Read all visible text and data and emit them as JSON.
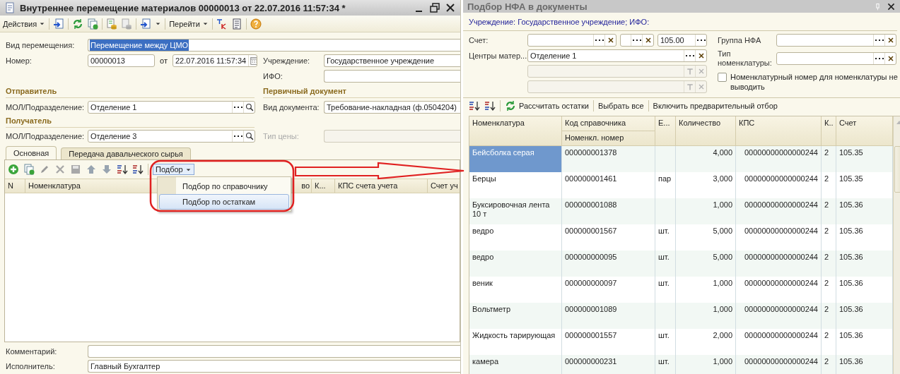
{
  "left_window": {
    "title": "Внутреннее перемещение материалов 00000013 от 22.07.2016 11:57:34 *",
    "toolbar": {
      "actions_menu": "Действия",
      "goto_menu": "Перейти"
    },
    "movement_type": {
      "label": "Вид перемещения:",
      "value": "Перемещение между ЦМО",
      "highlighted": true
    },
    "number": {
      "label": "Номер:",
      "value": "00000013"
    },
    "date": {
      "label": "от",
      "value": "22.07.2016 11:57:34"
    },
    "institution": {
      "label": "Учреждение:",
      "value": "Государственное учреждение"
    },
    "ifo": {
      "label": "ИФО:"
    },
    "sender": {
      "heading": "Отправитель",
      "label": "МОЛ/Подразделение:",
      "value": "Отделение 1"
    },
    "primary_document": {
      "heading": "Первичный документ",
      "label": "Вид документа:",
      "value": "Требование-накладная (ф.0504204)"
    },
    "recipient": {
      "heading": "Получатель",
      "label": "МОЛ/Подразделение:",
      "value": "Отделение 3"
    },
    "price_type": {
      "label": "Тип цены:",
      "disabled": true
    },
    "tabs": [
      {
        "label": "Основная",
        "selected": true
      },
      {
        "label": "Передача давальческого сырья",
        "selected": false
      }
    ],
    "pick_button": {
      "label": "Подбор",
      "pressed": true
    },
    "pick_menu": [
      {
        "label": "Подбор по справочнику",
        "selected": false
      },
      {
        "label": "Подбор по остаткам",
        "selected": true
      }
    ],
    "table": {
      "columns": [
        "N",
        "Номенклатура",
        "во",
        "К...",
        "КПС счета учета",
        "Счет уч"
      ]
    },
    "comment": {
      "label": "Комментарий:"
    },
    "executor": {
      "label": "Исполнитель:",
      "value": "Главный Бухгалтер"
    }
  },
  "right_window": {
    "title": "Подбор НФА в документы",
    "info": "Учреждение: Государственное учреждение; ИФО:",
    "account": {
      "label": "Счет:",
      "code": "105.00"
    },
    "centers": {
      "label": "Центры матер...",
      "value": "Отделение 1"
    },
    "nfa_group": {
      "label": "Группа НФА"
    },
    "nomenclature_type": {
      "label": "Тип номенклатуры:"
    },
    "hide_number": {
      "label": "Номенклатурный номер для номенклатуры не выводить",
      "checked": false
    },
    "toolbar": [
      "Рассчитать остатки",
      "Выбрать все",
      "Включить предварительный отбор"
    ],
    "table": {
      "columns": [
        {
          "label": "Номенклатура"
        },
        {
          "label": "Код справочника",
          "sublabel": "Номенкл. номер"
        },
        {
          "label": "Е..."
        },
        {
          "label": "Количество"
        },
        {
          "label": "КПС"
        },
        {
          "label": "К.."
        },
        {
          "label": "Счет"
        }
      ],
      "rows": [
        {
          "name": "Бейсболка серая",
          "code": "000000001378",
          "quantity": "4,000",
          "kps": "00000000000000244",
          "k": "2",
          "account": "105.35",
          "selected": true
        },
        {
          "name": "Берцы",
          "code": "000000001461",
          "unit": "пар",
          "quantity": "3,000",
          "kps": "00000000000000244",
          "k": "2",
          "account": "105.35",
          "selected": false
        },
        {
          "name": "Буксировочная лента 10 т",
          "code": "000000001088",
          "quantity": "1,000",
          "kps": "00000000000000244",
          "k": "2",
          "account": "105.36",
          "selected": false
        },
        {
          "name": "ведро",
          "code": "000000001567",
          "unit": "шт.",
          "quantity": "5,000",
          "kps": "00000000000000244",
          "k": "2",
          "account": "105.36",
          "selected": false
        },
        {
          "name": "ведро",
          "code": "000000000095",
          "unit": "шт.",
          "quantity": "5,000",
          "kps": "00000000000000244",
          "k": "2",
          "account": "105.36",
          "selected": false
        },
        {
          "name": "веник",
          "code": "000000000097",
          "unit": "шт.",
          "quantity": "1,000",
          "kps": "00000000000000244",
          "k": "2",
          "account": "105.36",
          "selected": false
        },
        {
          "name": "Вольтметр",
          "code": "000000001089",
          "quantity": "1,000",
          "kps": "00000000000000244",
          "k": "2",
          "account": "105.36",
          "selected": false
        },
        {
          "name": "Жидкость тарирующая",
          "code": "000000001557",
          "unit": "шт.",
          "quantity": "2,000",
          "kps": "00000000000000244",
          "k": "2",
          "account": "105.36",
          "selected": false
        },
        {
          "name": "камера",
          "code": "000000000231",
          "unit": "шт.",
          "quantity": "1,000",
          "kps": "00000000000000244",
          "k": "2",
          "account": "105.36",
          "selected": false
        }
      ]
    }
  }
}
